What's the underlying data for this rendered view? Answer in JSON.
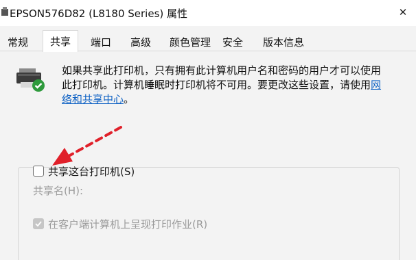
{
  "window": {
    "title": "EPSON576D82 (L8180 Series) 属性",
    "close_glyph": "✕"
  },
  "tabs": [
    {
      "label": "常规",
      "active": false
    },
    {
      "label": "共享",
      "active": true
    },
    {
      "label": "端口",
      "active": false
    },
    {
      "label": "高级",
      "active": false
    },
    {
      "label": "颜色管理",
      "active": false
    },
    {
      "label": "安全",
      "active": false
    },
    {
      "label": "版本信息",
      "active": false
    }
  ],
  "share": {
    "icon": "printer-check-icon",
    "description_line1": "如果共享此打印机，只有拥有此计算机用户名和密码的用户才可以使用",
    "description_line2": "此打印机。计算机睡眠时打印机将不可用。要更改这些设置，请使用",
    "link_part1": "网",
    "link_part2": "络和共享中心",
    "description_end": "。",
    "share_checkbox_label": "共享这台打印机(S)",
    "share_checked": false,
    "share_name_label": "共享名(H):",
    "render_jobs_label": "在客户端计算机上呈现打印作业(R)",
    "render_jobs_checked": true,
    "render_jobs_disabled": true
  },
  "colors": {
    "accent_link": "#0f62c4",
    "arrow": "#e0202a",
    "check_green": "#2e9a3c"
  },
  "annotation": {
    "icon": "red-dashed-arrow-icon"
  }
}
